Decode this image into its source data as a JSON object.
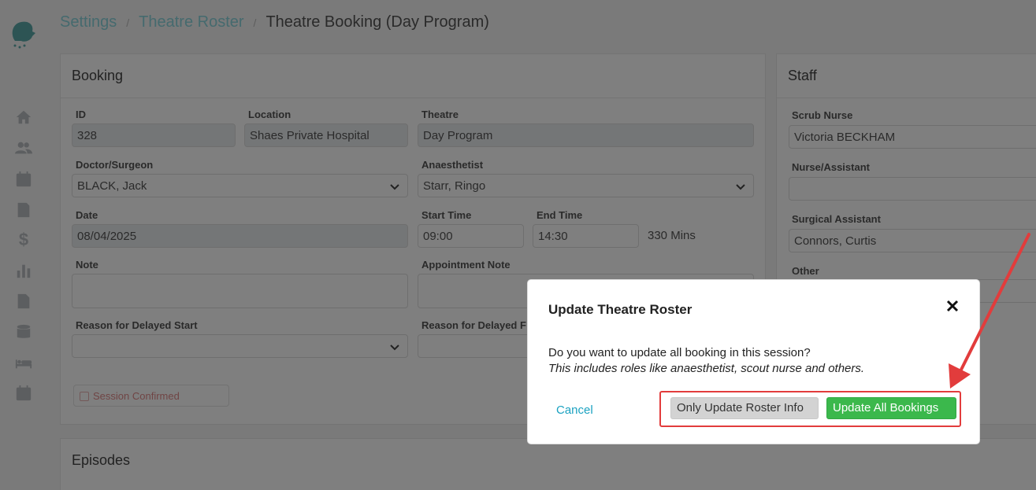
{
  "breadcrumb": {
    "items": [
      "Settings",
      "Theatre Roster"
    ],
    "current": "Theatre Booking (Day Program)"
  },
  "booking": {
    "title": "Booking",
    "id_label": "ID",
    "id_value": "328",
    "location_label": "Location",
    "location_value": "Shaes Private Hospital",
    "theatre_label": "Theatre",
    "theatre_value": "Day Program",
    "doctor_label": "Doctor/Surgeon",
    "doctor_value": "BLACK, Jack",
    "anaesthetist_label": "Anaesthetist",
    "anaesthetist_value": "Starr, Ringo",
    "date_label": "Date",
    "date_value": "08/04/2025",
    "start_label": "Start Time",
    "start_value": "09:00",
    "end_label": "End Time",
    "end_value": "14:30",
    "duration": "330 Mins",
    "note_label": "Note",
    "appointment_note_label": "Appointment Note",
    "delay_label": "Reason for Delayed Start",
    "delay_label_2": "Reason for Delayed F",
    "session_confirmed": "Session Confirmed"
  },
  "staff": {
    "title": "Staff",
    "scrub_label": "Scrub Nurse",
    "scrub_value": "Victoria BECKHAM",
    "nurse_label": "Nurse/Assistant",
    "surgical_label": "Surgical Assistant",
    "surgical_value": "Connors, Curtis",
    "other_label": "Other"
  },
  "episodes": {
    "title": "Episodes"
  },
  "modal": {
    "title": "Update Theatre Roster",
    "question": "Do you want to update all booking in this session?",
    "note": "This includes roles like anaesthetist, scout nurse and others.",
    "cancel": "Cancel",
    "only_update": "Only Update Roster Info",
    "update_all": "Update All Bookings"
  },
  "icons": [
    "logo-icon",
    "home-icon",
    "users-icon",
    "calendar-icon",
    "document-icon",
    "dollar-icon",
    "bar-chart-icon",
    "file-dollar-icon",
    "database-icon",
    "bed-icon",
    "calendar-plus-icon",
    "close-icon",
    "chevron-down-icon"
  ],
  "colors": {
    "link": "#1ba2c1",
    "success": "#3bb84c",
    "highlight": "#e23c3c",
    "breadcrumb": "#8ad4dc"
  }
}
